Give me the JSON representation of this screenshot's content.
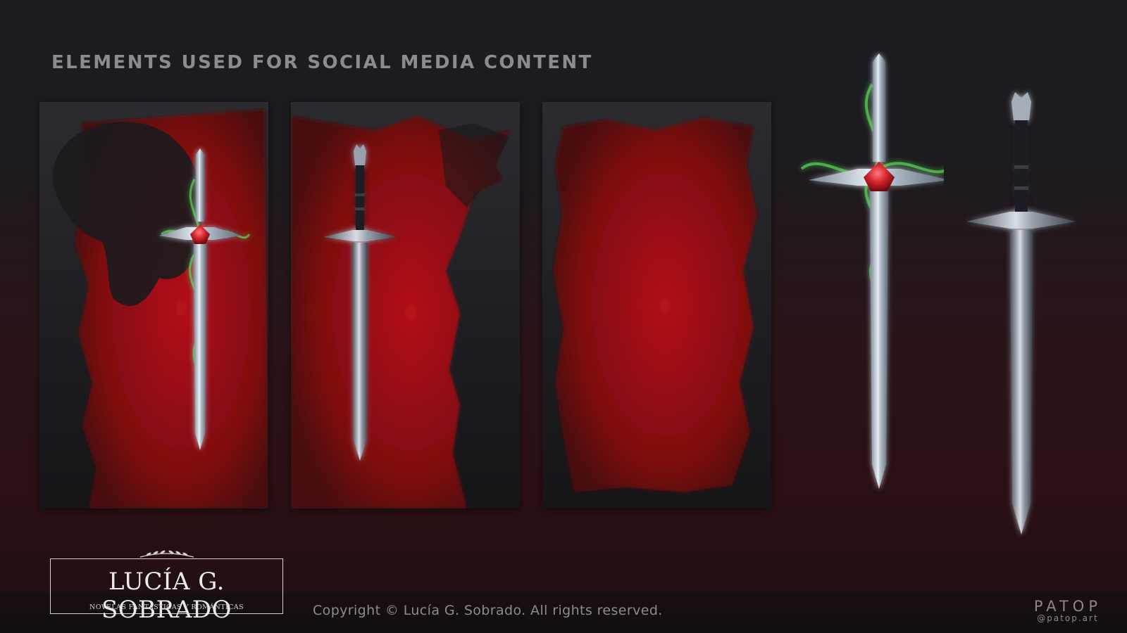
{
  "heading": "ELEMENTS USED FOR SOCIAL MEDIA CONTENT",
  "logo": {
    "name": "LUCÍA G. SOBRADO",
    "tagline": "NOVELAS FANTÁSTICAS Y ROMÁNTICAS"
  },
  "copyright": "Copyright © Lucía G. Sobrado. All rights reserved.",
  "brand": {
    "name": "PATOP",
    "handle": "@patop.art"
  },
  "colors": {
    "accent_red": "#8e0d12",
    "magic_green": "#5ad65a",
    "ruby": "#d4262e",
    "steel": "#cfd8e2"
  },
  "panels": [
    {
      "name": "panel-silhouette-girl-sword",
      "icon": "ruby-sword-icon"
    },
    {
      "name": "panel-wolf-sword",
      "icon": "wolf-sword-icon"
    },
    {
      "name": "panel-red-brushstroke",
      "icon": "brushstroke-icon"
    }
  ]
}
